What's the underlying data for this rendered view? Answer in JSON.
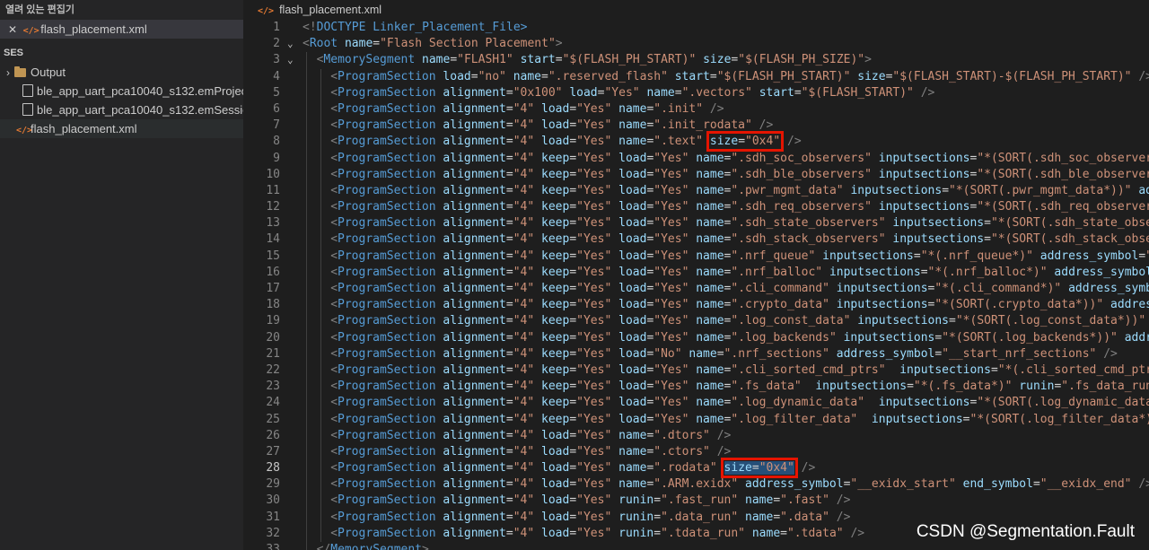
{
  "sidebar": {
    "open_editors_title": "열려 있는 편집기",
    "open_editor_file": "flash_placement.xml",
    "project_title": "SES",
    "tree": [
      {
        "kind": "folder",
        "label": "Output"
      },
      {
        "kind": "file",
        "label": "ble_app_uart_pca10040_s132.emProject"
      },
      {
        "kind": "file",
        "label": "ble_app_uart_pca10040_s132.emSession"
      },
      {
        "kind": "xml",
        "label": "flash_placement.xml"
      }
    ]
  },
  "editor": {
    "tab_title": "flash_placement.xml",
    "current_line": 28,
    "lines": [
      {
        "n": 1,
        "indent": 0,
        "raw": "<!DOCTYPE Linker_Placement_File>"
      },
      {
        "n": 2,
        "indent": 0,
        "fold": true,
        "raw": "<Root name=\"Flash Section Placement\">"
      },
      {
        "n": 3,
        "indent": 1,
        "fold": true,
        "raw": "<MemorySegment name=\"FLASH1\" start=\"$(FLASH_PH_START)\" size=\"$(FLASH_PH_SIZE)\">"
      },
      {
        "n": 4,
        "indent": 2,
        "raw": "<ProgramSection load=\"no\" name=\".reserved_flash\" start=\"$(FLASH_PH_START)\" size=\"$(FLASH_START)-$(FLASH_PH_START)\" />"
      },
      {
        "n": 5,
        "indent": 2,
        "raw": "<ProgramSection alignment=\"0x100\" load=\"Yes\" name=\".vectors\" start=\"$(FLASH_START)\" />"
      },
      {
        "n": 6,
        "indent": 2,
        "raw": "<ProgramSection alignment=\"4\" load=\"Yes\" name=\".init\" />"
      },
      {
        "n": 7,
        "indent": 2,
        "raw": "<ProgramSection alignment=\"4\" load=\"Yes\" name=\".init_rodata\" />"
      },
      {
        "n": 8,
        "indent": 2,
        "raw": "<ProgramSection alignment=\"4\" load=\"Yes\" name=\".text\" size=\"0x4\" />",
        "highlight": "size=\"0x4\""
      },
      {
        "n": 9,
        "indent": 2,
        "raw": "<ProgramSection alignment=\"4\" keep=\"Yes\" load=\"Yes\" name=\".sdh_soc_observers\" inputsections=\"*(SORT(.sdh_soc_observers*))\" address_symbol=\"__start_sdh_soc_observers\""
      },
      {
        "n": 10,
        "indent": 2,
        "raw": "<ProgramSection alignment=\"4\" keep=\"Yes\" load=\"Yes\" name=\".sdh_ble_observers\" inputsections=\"*(SORT(.sdh_ble_observers*))\" address_symbol=\"__start_sdh_ble_observers\""
      },
      {
        "n": 11,
        "indent": 2,
        "raw": "<ProgramSection alignment=\"4\" keep=\"Yes\" load=\"Yes\" name=\".pwr_mgmt_data\" inputsections=\"*(SORT(.pwr_mgmt_data*))\" address_symbol=\"__start_pwr_mgmt_data\""
      },
      {
        "n": 12,
        "indent": 2,
        "raw": "<ProgramSection alignment=\"4\" keep=\"Yes\" load=\"Yes\" name=\".sdh_req_observers\" inputsections=\"*(SORT(.sdh_req_observers*))\" address_symbol=\"__start_sdh_req_observers\""
      },
      {
        "n": 13,
        "indent": 2,
        "raw": "<ProgramSection alignment=\"4\" keep=\"Yes\" load=\"Yes\" name=\".sdh_state_observers\" inputsections=\"*(SORT(.sdh_state_observers*))\" address_symbol=\"__start_sdh_state_observers\""
      },
      {
        "n": 14,
        "indent": 2,
        "raw": "<ProgramSection alignment=\"4\" keep=\"Yes\" load=\"Yes\" name=\".sdh_stack_observers\" inputsections=\"*(SORT(.sdh_stack_observers*))\" address_symbol=\"__start_sdh_stack_observers\""
      },
      {
        "n": 15,
        "indent": 2,
        "raw": "<ProgramSection alignment=\"4\" keep=\"Yes\" load=\"Yes\" name=\".nrf_queue\" inputsections=\"*(.nrf_queue*)\" address_symbol=\"__start_nrf_queue\""
      },
      {
        "n": 16,
        "indent": 2,
        "raw": "<ProgramSection alignment=\"4\" keep=\"Yes\" load=\"Yes\" name=\".nrf_balloc\" inputsections=\"*(.nrf_balloc*)\" address_symbol=\"__start_nrf_balloc\""
      },
      {
        "n": 17,
        "indent": 2,
        "raw": "<ProgramSection alignment=\"4\" keep=\"Yes\" load=\"Yes\" name=\".cli_command\" inputsections=\"*(.cli_command*)\" address_symbol=\"__start_cli_command\""
      },
      {
        "n": 18,
        "indent": 2,
        "raw": "<ProgramSection alignment=\"4\" keep=\"Yes\" load=\"Yes\" name=\".crypto_data\" inputsections=\"*(SORT(.crypto_data*))\" address_symbol=\"__start_crypto_data\""
      },
      {
        "n": 19,
        "indent": 2,
        "raw": "<ProgramSection alignment=\"4\" keep=\"Yes\" load=\"Yes\" name=\".log_const_data\" inputsections=\"*(SORT(.log_const_data*))\" address_symbol=\"__start_log_const_data\""
      },
      {
        "n": 20,
        "indent": 2,
        "raw": "<ProgramSection alignment=\"4\" keep=\"Yes\" load=\"Yes\" name=\".log_backends\" inputsections=\"*(SORT(.log_backends*))\" address_symbol=\"__start_log_backends\""
      },
      {
        "n": 21,
        "indent": 2,
        "raw": "<ProgramSection alignment=\"4\" keep=\"Yes\" load=\"No\" name=\".nrf_sections\" address_symbol=\"__start_nrf_sections\" />"
      },
      {
        "n": 22,
        "indent": 2,
        "raw": "<ProgramSection alignment=\"4\" keep=\"Yes\" load=\"Yes\" name=\".cli_sorted_cmd_ptrs\"  inputsections=\"*(.cli_sorted_cmd_ptrs*)\" runin=\".cli_sorted_cmd_ptrs_run\"/>"
      },
      {
        "n": 23,
        "indent": 2,
        "raw": "<ProgramSection alignment=\"4\" keep=\"Yes\" load=\"Yes\" name=\".fs_data\"  inputsections=\"*(.fs_data*)\" runin=\".fs_data_run\"/>"
      },
      {
        "n": 24,
        "indent": 2,
        "raw": "<ProgramSection alignment=\"4\" keep=\"Yes\" load=\"Yes\" name=\".log_dynamic_data\"  inputsections=\"*(SORT(.log_dynamic_data*))\" runin=\".log_dynamic_data_run\"/>"
      },
      {
        "n": 25,
        "indent": 2,
        "raw": "<ProgramSection alignment=\"4\" keep=\"Yes\" load=\"Yes\" name=\".log_filter_data\"  inputsections=\"*(SORT(.log_filter_data*))\" runin=\".log_filter_data_run\"/>"
      },
      {
        "n": 26,
        "indent": 2,
        "raw": "<ProgramSection alignment=\"4\" load=\"Yes\" name=\".dtors\" />"
      },
      {
        "n": 27,
        "indent": 2,
        "raw": "<ProgramSection alignment=\"4\" load=\"Yes\" name=\".ctors\" />"
      },
      {
        "n": 28,
        "indent": 2,
        "raw": "<ProgramSection alignment=\"4\" load=\"Yes\" name=\".rodata\" size=\"0x4\" />",
        "highlight": "size=\"0x4\"",
        "selected": true
      },
      {
        "n": 29,
        "indent": 2,
        "raw": "<ProgramSection alignment=\"4\" load=\"Yes\" name=\".ARM.exidx\" address_symbol=\"__exidx_start\" end_symbol=\"__exidx_end\" />"
      },
      {
        "n": 30,
        "indent": 2,
        "raw": "<ProgramSection alignment=\"4\" load=\"Yes\" runin=\".fast_run\" name=\".fast\" />"
      },
      {
        "n": 31,
        "indent": 2,
        "raw": "<ProgramSection alignment=\"4\" load=\"Yes\" runin=\".data_run\" name=\".data\" />"
      },
      {
        "n": 32,
        "indent": 2,
        "raw": "<ProgramSection alignment=\"4\" load=\"Yes\" runin=\".tdata_run\" name=\".tdata\" />"
      },
      {
        "n": 33,
        "indent": 1,
        "raw": "</MemorySegment>"
      }
    ]
  },
  "watermark": "CSDN @Segmentation.Fault",
  "colors": {
    "tag": "#569cd6",
    "attribute": "#9cdcfe",
    "string": "#ce9178",
    "punctuation": "#808080",
    "highlight_box": "#e51400",
    "selection": "#264f78",
    "xml_icon": "#e37933"
  }
}
